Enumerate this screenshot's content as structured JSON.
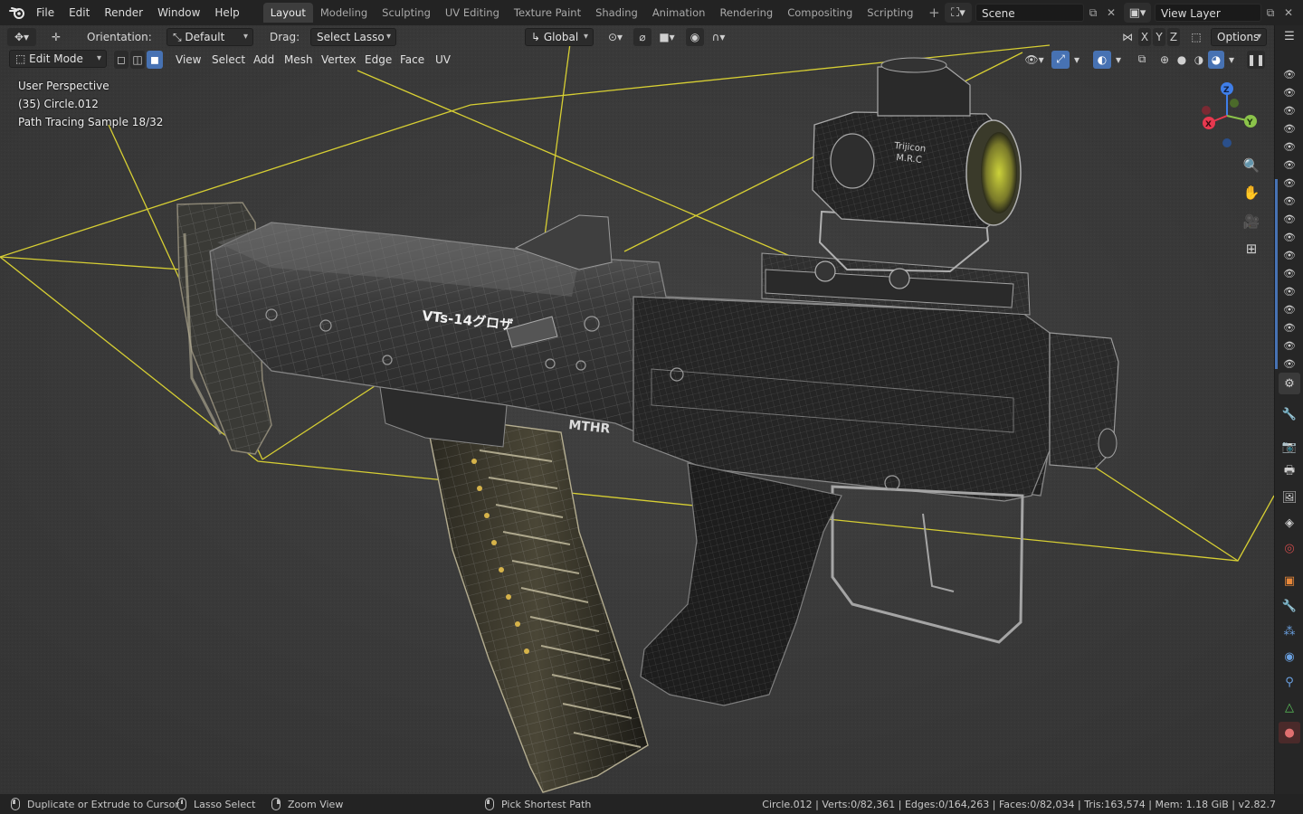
{
  "topbar": {
    "app_icon": "blender-logo-icon",
    "menu": [
      "File",
      "Edit",
      "Render",
      "Window",
      "Help"
    ],
    "workspace_tabs": [
      {
        "label": "Layout",
        "active": true
      },
      {
        "label": "Modeling",
        "active": false
      },
      {
        "label": "Sculpting",
        "active": false
      },
      {
        "label": "UV Editing",
        "active": false
      },
      {
        "label": "Texture Paint",
        "active": false
      },
      {
        "label": "Shading",
        "active": false
      },
      {
        "label": "Animation",
        "active": false
      },
      {
        "label": "Rendering",
        "active": false
      },
      {
        "label": "Compositing",
        "active": false
      },
      {
        "label": "Scripting",
        "active": false
      }
    ],
    "add_workspace": "+",
    "scene_name": "Scene",
    "view_layer": "View Layer"
  },
  "tool_header": {
    "orientation_label": "Orientation:",
    "orientation_value": "Default",
    "drag_label": "Drag:",
    "drag_value": "Select Lasso",
    "transform_orientation": "Global",
    "axis_x": "X",
    "axis_y": "Y",
    "axis_z": "Z",
    "options": "Options"
  },
  "viewport_header": {
    "mode": "Edit Mode",
    "menu": [
      "View",
      "Select",
      "Add",
      "Mesh",
      "Vertex",
      "Edge",
      "Face",
      "UV"
    ]
  },
  "viewport_overlay": {
    "perspective": "User Perspective",
    "object": "(35) Circle.012",
    "render_status": "Path Tracing Sample 18/32"
  },
  "model_decals": {
    "receiver_text": "VTs-14グロザ",
    "maker_text": "MTHR",
    "sight_brand": "Trijicon",
    "sight_model": "M.R.C"
  },
  "gizmo": {
    "x": "X",
    "y": "Y",
    "z": "Z"
  },
  "statusbar": {
    "hint_left": "Duplicate or Extrude to Cursor",
    "hint_mid1": "Lasso Select",
    "hint_mid2": "Zoom View",
    "hint_right": "Pick Shortest Path",
    "stats": "Circle.012 | Verts:0/82,361 | Edges:0/164,263 | Faces:0/82,034 | Tris:163,574 | Mem: 1.18 GiB | v2.82.7"
  },
  "colors": {
    "accent_blue": "#4772b3",
    "active_tab": "#3d3d3d",
    "viewport_bg": "#3b3b3b",
    "camera_wire": "#d7cf33",
    "axis_x": "#e8384f",
    "axis_y": "#8bc34a",
    "axis_z": "#3f7ee8"
  }
}
